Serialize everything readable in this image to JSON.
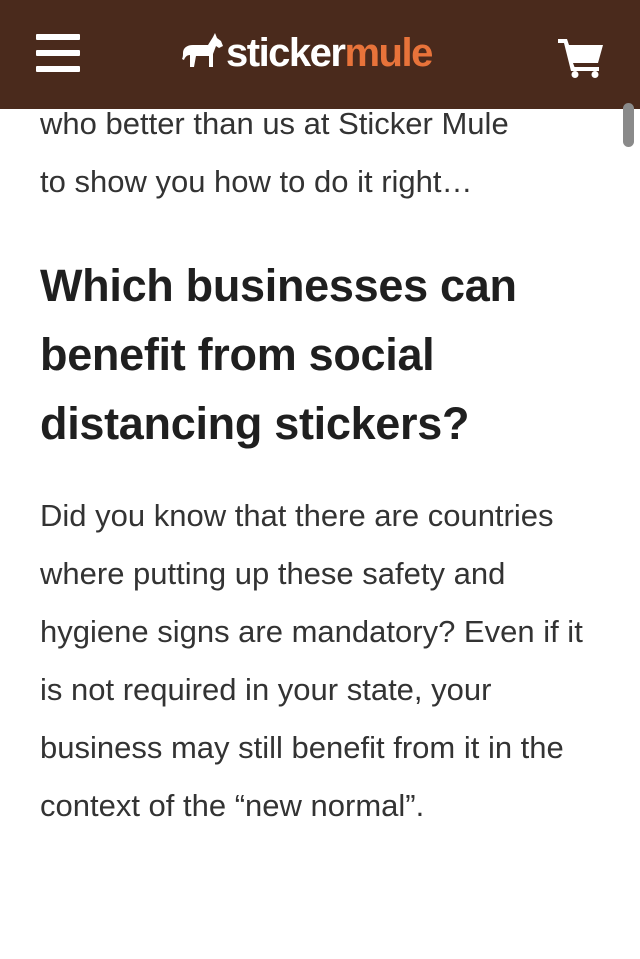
{
  "header": {
    "brand_part1": "sticker",
    "brand_part2": "mule",
    "colors": {
      "bar": "#4a2a1c",
      "brand_accent": "#e8733a",
      "brand_light": "#ffffff"
    },
    "icons": [
      "menu-icon",
      "mule-logo-icon",
      "cart-icon"
    ]
  },
  "article": {
    "intro_line1": "who better than us at Sticker Mule",
    "intro_line2": "to show you how to do it right…",
    "heading": "Which businesses can benefit from social distancing stickers?",
    "paragraph": "Did you know that there are countries where putting up these safety and hygiene signs are mandatory? Even if it is not required in your state, your business may still benefit from it in the context of the “new normal”."
  }
}
